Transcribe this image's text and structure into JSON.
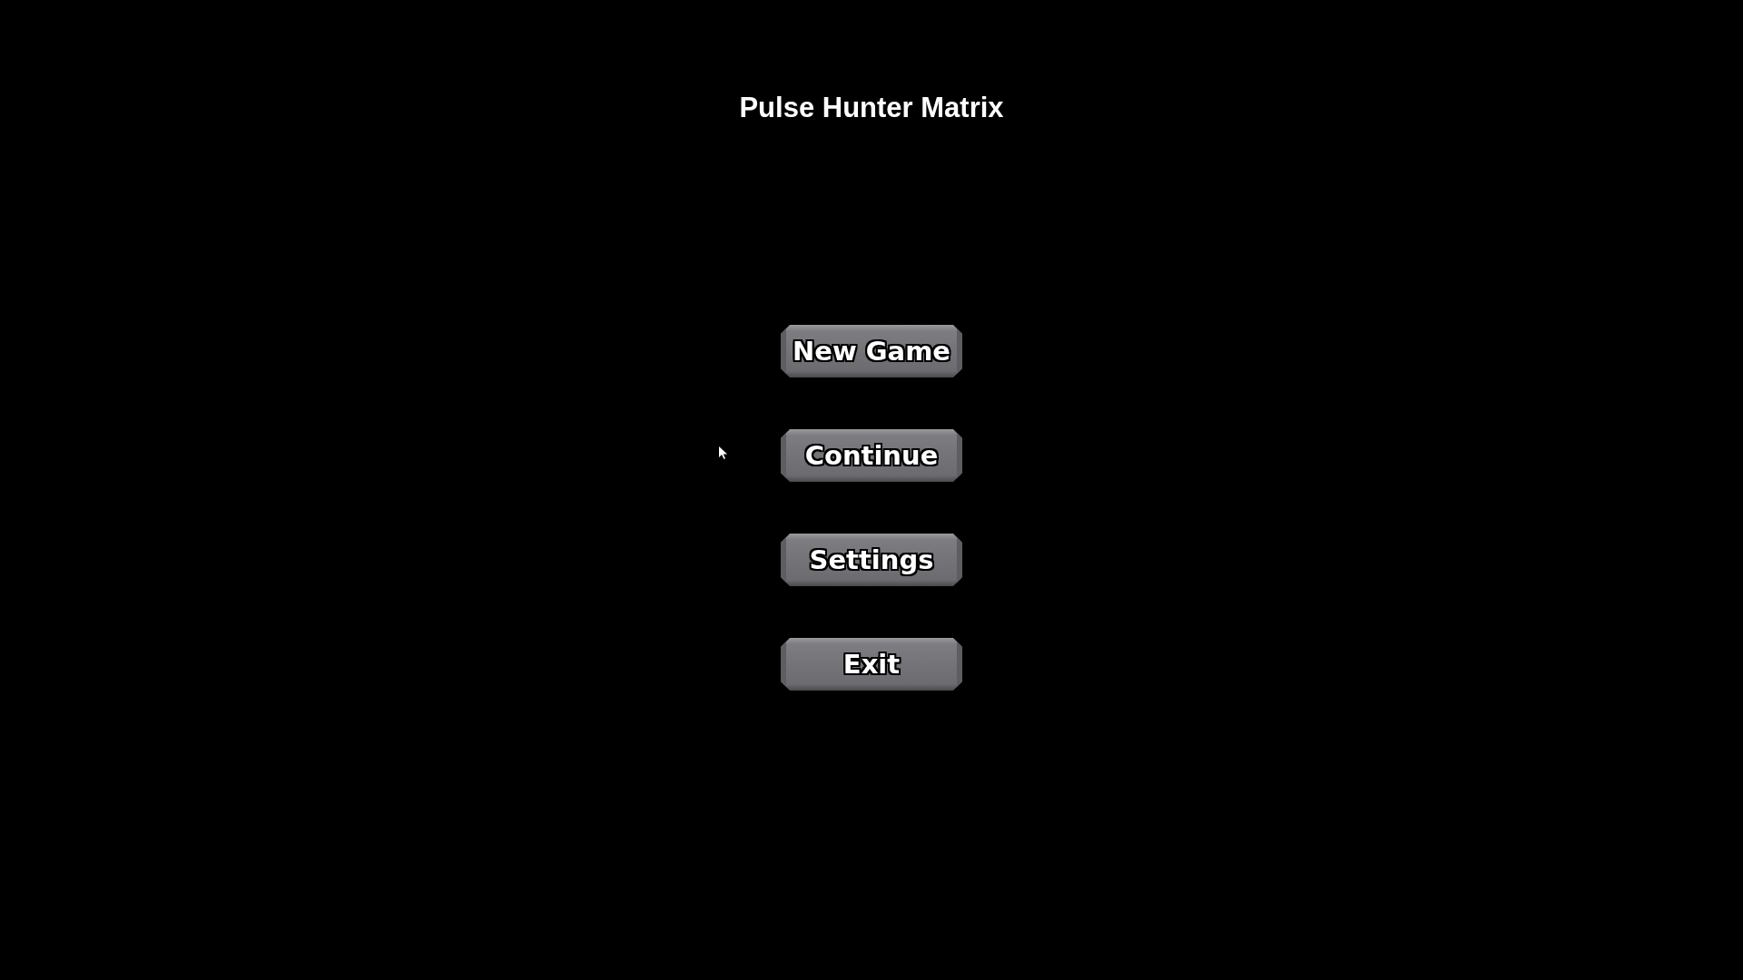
{
  "title": "Pulse Hunter Matrix",
  "menu": [
    {
      "label": "New Game"
    },
    {
      "label": "Continue"
    },
    {
      "label": "Settings"
    },
    {
      "label": "Exit"
    }
  ]
}
